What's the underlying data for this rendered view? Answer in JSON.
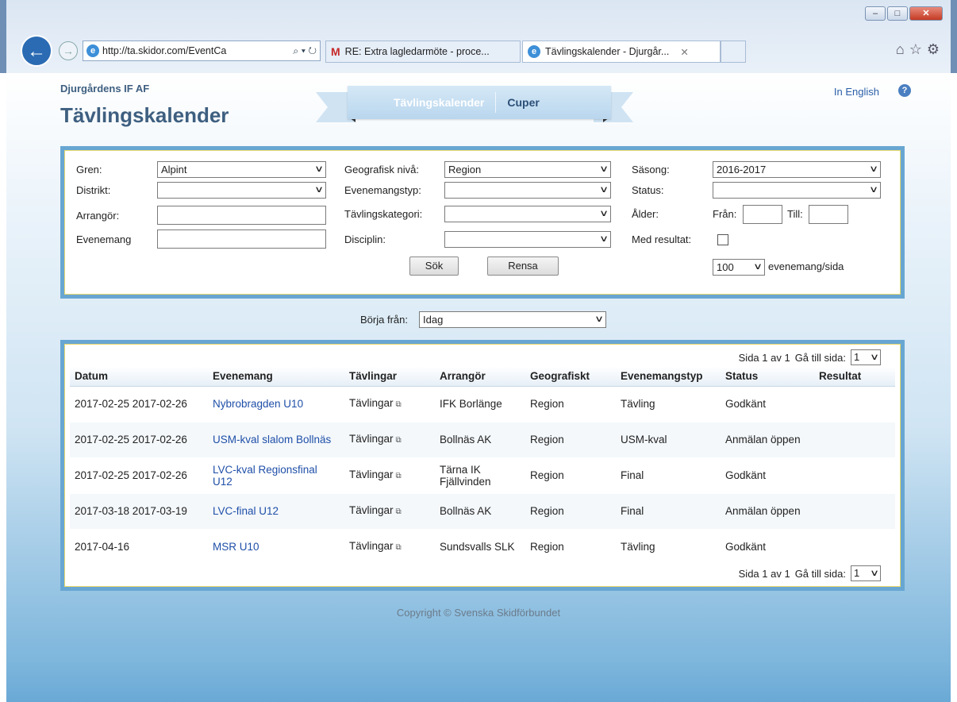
{
  "browser": {
    "address_url": "http://ta.skidor.com/EventCa",
    "tabs": [
      {
        "title": "RE: Extra lagledarmöte - proce..."
      },
      {
        "title": "Tävlingskalender - Djurgår..."
      }
    ],
    "window_min": "–",
    "window_max": "□",
    "window_close": "✕"
  },
  "header": {
    "club": "Djurgårdens IF AF",
    "title": "Tävlingskalender",
    "in_english": "In English",
    "nav": {
      "active": "Tävlingskalender",
      "other": "Cuper"
    }
  },
  "filters": {
    "gren_label": "Gren:",
    "gren_value": "Alpint",
    "distrikt_label": "Distrikt:",
    "distrikt_value": "",
    "arrangor_label": "Arrangör:",
    "arrangor_value": "",
    "evenemang_label": "Evenemang",
    "evenemang_value": "",
    "geo_label": "Geografisk nivå:",
    "geo_value": "Region",
    "evtyp_label": "Evenemangstyp:",
    "evtyp_value": "",
    "kategori_label": "Tävlingskategori:",
    "kategori_value": "",
    "disciplin_label": "Disciplin:",
    "disciplin_value": "",
    "sasong_label": "Säsong:",
    "sasong_value": "2016-2017",
    "status_label": "Status:",
    "status_value": "",
    "alder_label": "Ålder:",
    "fran_label": "Från:",
    "till_label": "Till:",
    "fran_value": "",
    "till_value": "",
    "med_resultat_label": "Med resultat:",
    "search_button": "Sök",
    "clear_button": "Rensa",
    "per_page_value": "100",
    "per_page_label": "evenemang/sida"
  },
  "start": {
    "label": "Börja från:",
    "value": "Idag"
  },
  "results": {
    "pager_text": "Sida 1 av 1",
    "goto_label": "Gå till sida:",
    "goto_value": "1",
    "columns": [
      "Datum",
      "Evenemang",
      "Tävlingar",
      "Arrangör",
      "Geografiskt",
      "Evenemangstyp",
      "Status",
      "Resultat"
    ],
    "rows": [
      {
        "datum": "2017-02-25 2017-02-26",
        "evenemang": "Nybrobragden U10",
        "tavlingar": "Tävlingar",
        "arrangor": "IFK Borlänge",
        "geo": "Region",
        "typ": "Tävling",
        "status": "Godkänt",
        "resultat": ""
      },
      {
        "datum": "2017-02-25 2017-02-26",
        "evenemang": "USM-kval slalom Bollnäs",
        "tavlingar": "Tävlingar",
        "arrangor": "Bollnäs AK",
        "geo": "Region",
        "typ": "USM-kval",
        "status": "Anmälan öppen",
        "resultat": ""
      },
      {
        "datum": "2017-02-25 2017-02-26",
        "evenemang": "LVC-kval Regionsfinal U12",
        "tavlingar": "Tävlingar",
        "arrangor": "Tärna IK Fjällvinden",
        "geo": "Region",
        "typ": "Final",
        "status": "Godkänt",
        "resultat": ""
      },
      {
        "datum": "2017-03-18 2017-03-19",
        "evenemang": "LVC-final U12",
        "tavlingar": "Tävlingar",
        "arrangor": "Bollnäs AK",
        "geo": "Region",
        "typ": "Final",
        "status": "Anmälan öppen",
        "resultat": ""
      },
      {
        "datum": "2017-04-16",
        "evenemang": "MSR U10",
        "tavlingar": "Tävlingar",
        "arrangor": "Sundsvalls SLK",
        "geo": "Region",
        "typ": "Tävling",
        "status": "Godkänt",
        "resultat": ""
      }
    ]
  },
  "footer": {
    "copyright": "Copyright © Svenska Skidförbundet"
  }
}
